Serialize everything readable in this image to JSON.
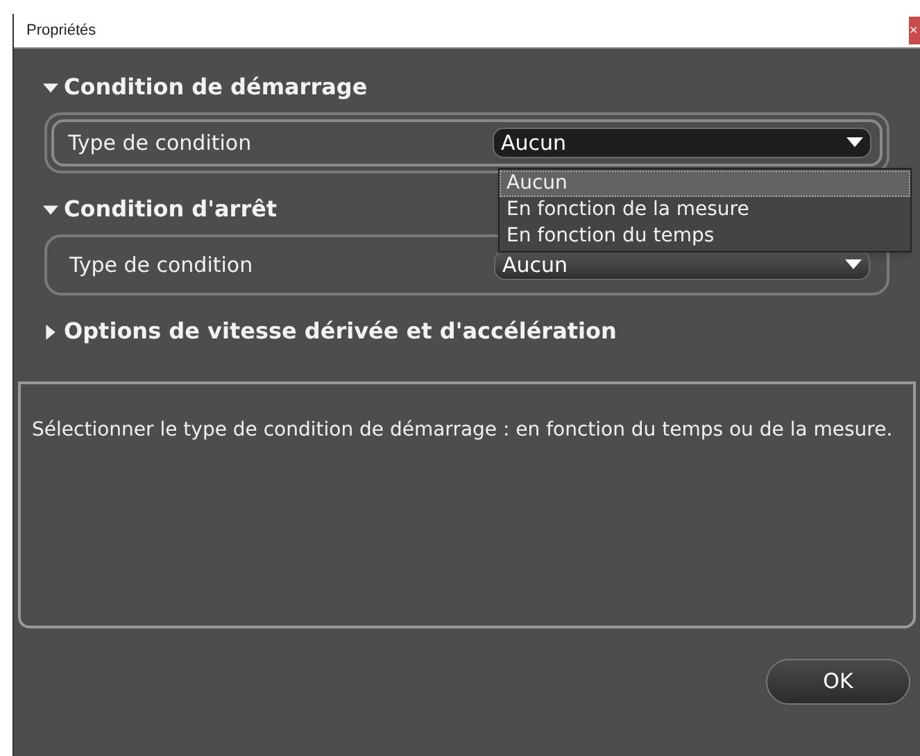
{
  "window": {
    "title": "Propriétés",
    "close": "×"
  },
  "sections": [
    {
      "title": "Condition de démarrage",
      "expanded": true,
      "field": {
        "label": "Type de condition",
        "value": "Aucun",
        "open": true,
        "options": [
          {
            "label": "Aucun",
            "selected": true
          },
          {
            "label": "En fonction de la mesure",
            "selected": false
          },
          {
            "label": "En fonction du temps",
            "selected": false
          }
        ]
      }
    },
    {
      "title": "Condition d'arrêt",
      "expanded": true,
      "field": {
        "label": "Type de condition",
        "value": "Aucun",
        "open": false
      }
    },
    {
      "title": "Options de vitesse dérivée et d'accélération",
      "expanded": false
    }
  ],
  "description": "Sélectionner le type de condition de démarrage : en fonction du temps ou de la mesure.",
  "buttons": [
    "OK"
  ]
}
